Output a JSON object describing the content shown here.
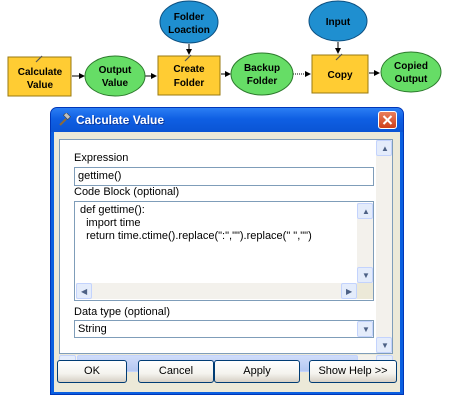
{
  "diagram": {
    "nodes": {
      "calculate_value": [
        "Calculate",
        "Value"
      ],
      "output_value": [
        "Output",
        "Value"
      ],
      "create_folder": [
        "Create",
        "Folder"
      ],
      "folder_location": [
        "Folder",
        "Loaction"
      ],
      "backup_folder": [
        "Backup",
        "Folder"
      ],
      "copy": "Copy",
      "input": "Input",
      "copied_output": [
        "Copied",
        "Output"
      ]
    },
    "colors": {
      "tool": "#ffcc33",
      "data_green": "#66dd66",
      "data_blue": "#1f8fd0"
    }
  },
  "dialog": {
    "title": "Calculate Value",
    "expression_label": "Expression",
    "expression_value": "gettime()",
    "code_block_label": "Code Block (optional)",
    "code_lines": [
      "def gettime():",
      "  import time",
      "  return time.ctime().replace(\":\",\"\").replace(\" \",\"\")"
    ],
    "data_type_label": "Data type (optional)",
    "data_type_value": "String",
    "buttons": {
      "ok": "OK",
      "cancel": "Cancel",
      "apply": "Apply",
      "show_help": "Show Help >>"
    }
  }
}
